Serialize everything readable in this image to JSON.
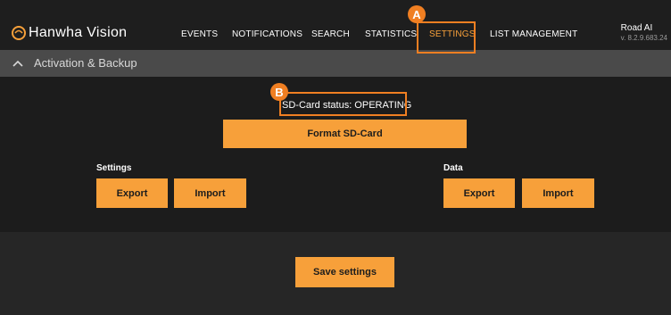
{
  "brand": {
    "name": "Hanwha Vision",
    "icon": "hanwha-logo-icon"
  },
  "nav": {
    "items": [
      {
        "label": "EVENTS",
        "active": false
      },
      {
        "label": "NOTIFICATIONS",
        "active": false
      },
      {
        "label": "SEARCH",
        "active": false
      },
      {
        "label": "STATISTICS",
        "active": false
      },
      {
        "label": "SETTINGS",
        "active": true
      },
      {
        "label": "LIST MANAGEMENT",
        "active": false
      }
    ]
  },
  "user": {
    "name": "Road AI",
    "version": "v. 8.2.9.683.24"
  },
  "section": {
    "title": "Activation & Backup",
    "icon": "chevron-up-icon"
  },
  "sd_card": {
    "status": "SD-Card status: OPERATING",
    "format_label": "Format SD-Card"
  },
  "settings_group": {
    "label": "Settings",
    "export_label": "Export",
    "import_label": "Import"
  },
  "data_group": {
    "label": "Data",
    "export_label": "Export",
    "import_label": "Import"
  },
  "save_label": "Save settings",
  "callouts": {
    "a": "A",
    "b": "B"
  },
  "colors": {
    "accent": "#f7a03a",
    "callout": "#f07f22",
    "topbar": "#1e1e1e",
    "panel": "#1c1c1c"
  }
}
